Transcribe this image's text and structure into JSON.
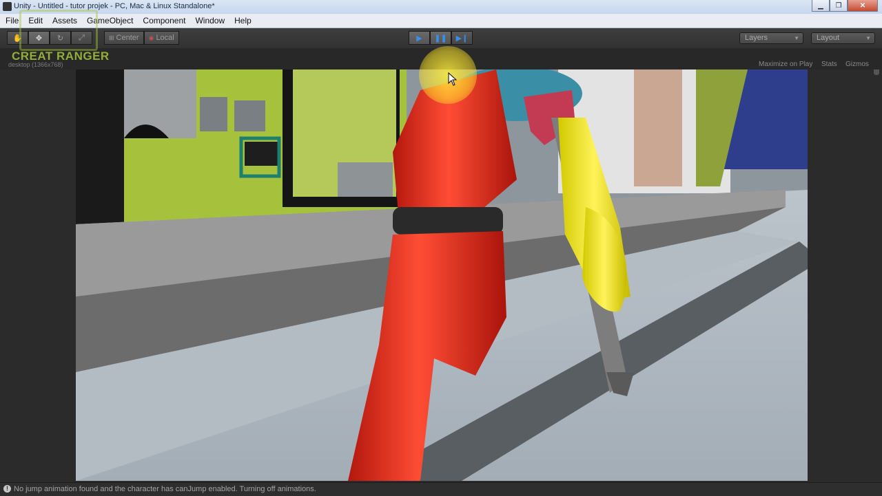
{
  "window": {
    "title": "Unity - Untitled - tutor projek - PC, Mac & Linux Standalone*",
    "minimize_icon": "minimize-icon",
    "maximize_icon": "restore-icon",
    "close_icon": "close-icon"
  },
  "menu": {
    "items": [
      "File",
      "Edit",
      "Assets",
      "GameObject",
      "Component",
      "Window",
      "Help"
    ]
  },
  "toolbar": {
    "tools": [
      "hand-icon",
      "move-icon",
      "rotate-icon",
      "scale-icon"
    ],
    "pivot_label": "Center",
    "space_label": "Local",
    "playback": [
      "play-icon",
      "pause-icon",
      "step-icon"
    ],
    "play_active": true,
    "pause_active": true,
    "layers_label": "Layers",
    "layout_label": "Layout"
  },
  "game_view": {
    "resolution": "desktop (1366x768)",
    "options": [
      "Maximize on Play",
      "Stats",
      "Gizmos"
    ]
  },
  "watermark": "CREAT RANGER",
  "status": {
    "message": "No jump animation found and the character has canJump enabled. Turning off animations."
  },
  "colors": {
    "accent_play": "#3a8ee6",
    "watermark": "#a7c63c",
    "cursor_highlight": "#ffe93c"
  }
}
